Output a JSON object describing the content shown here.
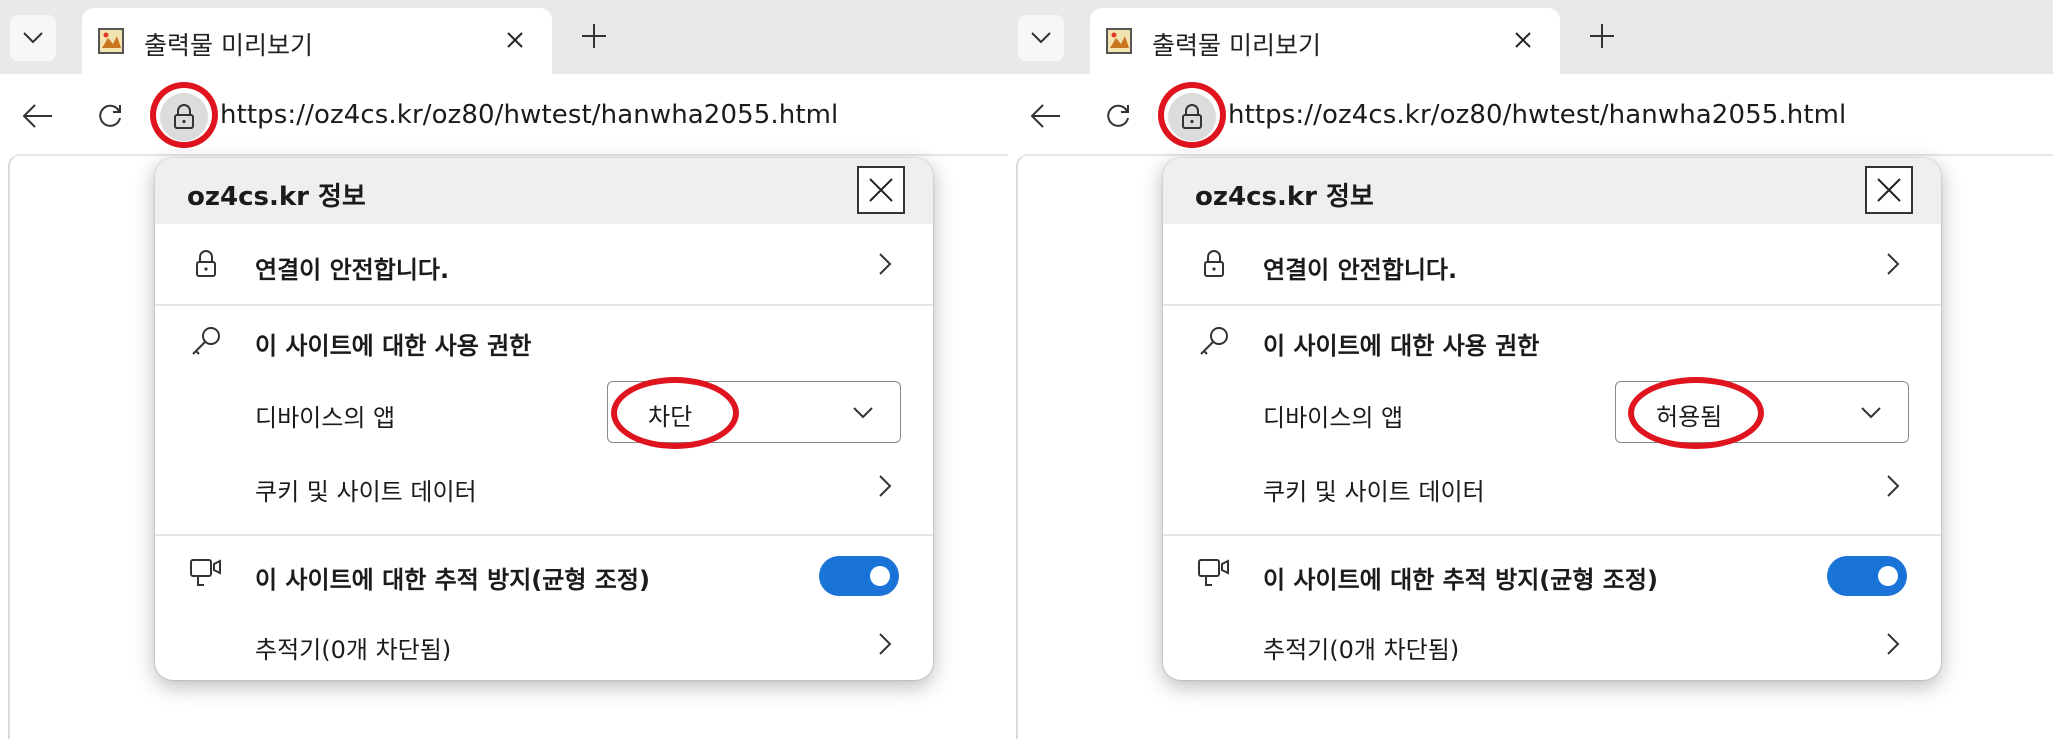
{
  "accent_color": "#1a73d6",
  "annotation_color": "#e0141e",
  "panes": [
    {
      "tab": {
        "title": "출력물 미리보기",
        "favicon": "printer-image-icon",
        "close": "close-icon"
      },
      "new_tab": "plus-icon",
      "address_bar": {
        "url": "https://oz4cs.kr/oz80/hwtest/hanwha2055.html",
        "site_info_icon": "lock-icon"
      },
      "site_info": {
        "title": "oz4cs.kr 정보",
        "connection": "연결이 안전합니다.",
        "permissions_heading": "이 사이트에 대한 사용 권한",
        "device_apps_label": "디바이스의 앱",
        "device_apps_value": "차단",
        "cookies_label": "쿠키 및 사이트 데이터",
        "tracking_heading": "이 사이트에 대한 추적 방지(균형 조정)",
        "tracking_enabled": true,
        "trackers_label": "추적기(0개 차단됨)"
      }
    },
    {
      "tab": {
        "title": "출력물 미리보기",
        "favicon": "printer-image-icon",
        "close": "close-icon"
      },
      "new_tab": "plus-icon",
      "address_bar": {
        "url": "https://oz4cs.kr/oz80/hwtest/hanwha2055.html",
        "site_info_icon": "lock-icon"
      },
      "site_info": {
        "title": "oz4cs.kr 정보",
        "connection": "연결이 안전합니다.",
        "permissions_heading": "이 사이트에 대한 사용 권한",
        "device_apps_label": "디바이스의 앱",
        "device_apps_value": "허용됨",
        "cookies_label": "쿠키 및 사이트 데이터",
        "tracking_heading": "이 사이트에 대한 추적 방지(균형 조정)",
        "tracking_enabled": true,
        "trackers_label": "추적기(0개 차단됨)"
      }
    }
  ]
}
